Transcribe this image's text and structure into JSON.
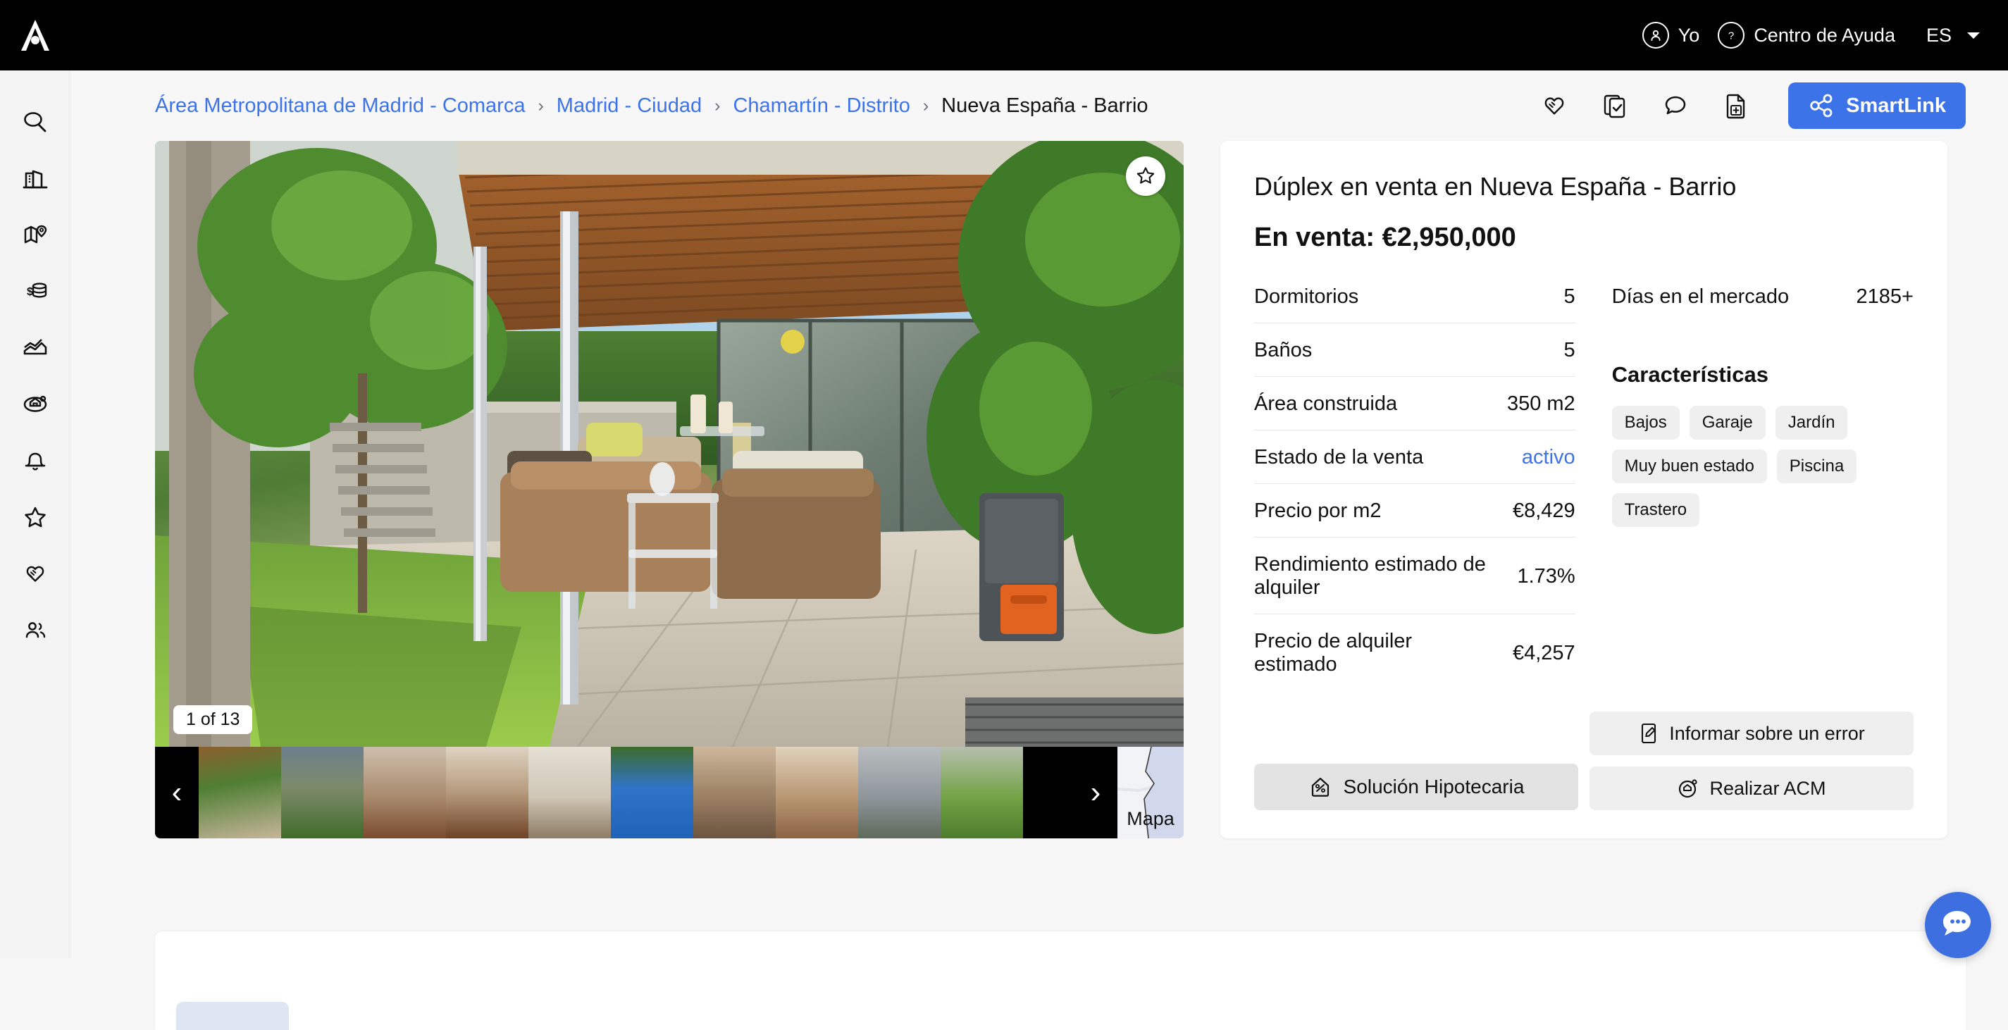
{
  "brand": {
    "logo_name": "a-logo",
    "accent": "#3d73e8"
  },
  "topbar": {
    "account_label": "Yo",
    "help_label": "Centro de Ayuda",
    "language": "ES"
  },
  "sidebar": {
    "items": [
      {
        "name": "search",
        "label": "Buscar"
      },
      {
        "name": "buildings",
        "label": "Edificios"
      },
      {
        "name": "map",
        "label": "Mapa"
      },
      {
        "name": "finance",
        "label": "Finanzas"
      },
      {
        "name": "analytics",
        "label": "Analítica"
      },
      {
        "name": "valuation",
        "label": "Valoración"
      },
      {
        "name": "alerts",
        "label": "Alertas"
      },
      {
        "name": "favorites",
        "label": "Favoritos"
      },
      {
        "name": "deals",
        "label": "Acuerdos"
      },
      {
        "name": "contacts",
        "label": "Contactos"
      }
    ]
  },
  "breadcrumb": {
    "items": [
      {
        "label": "Área Metropolitana de Madrid - Comarca",
        "current": false
      },
      {
        "label": "Madrid - Ciudad",
        "current": false
      },
      {
        "label": "Chamartín - Distrito",
        "current": false
      },
      {
        "label": "Nueva España - Barrio",
        "current": true
      }
    ],
    "separator": "›"
  },
  "header_actions": {
    "icons": [
      {
        "name": "handshake-icon"
      },
      {
        "name": "document-check-icon"
      },
      {
        "name": "chat-bubble-icon"
      },
      {
        "name": "document-add-icon"
      }
    ],
    "smartlink_label": "SmartLink"
  },
  "gallery": {
    "counter": "1 of 13",
    "prev_label": "‹",
    "next_label": "›",
    "map_label": "Mapa",
    "favorite_icon": "star-icon",
    "thumbnails": [
      {
        "name": "thumb-terrace"
      },
      {
        "name": "thumb-garden"
      },
      {
        "name": "thumb-living-room"
      },
      {
        "name": "thumb-dining"
      },
      {
        "name": "thumb-lounge"
      },
      {
        "name": "thumb-pool"
      },
      {
        "name": "thumb-bathroom"
      },
      {
        "name": "thumb-hallway"
      },
      {
        "name": "thumb-facade"
      },
      {
        "name": "thumb-lawn"
      }
    ]
  },
  "listing": {
    "title": "Dúplex en venta en Nueva España - Barrio",
    "price_label": "En venta: €2,950,000",
    "details_left": [
      {
        "label": "Dormitorios",
        "value": "5",
        "is_link": false
      },
      {
        "label": "Baños",
        "value": "5",
        "is_link": false
      },
      {
        "label": "Área construida",
        "value": "350 m2",
        "is_link": false
      },
      {
        "label": "Estado de la venta",
        "value": "activo",
        "is_link": true
      },
      {
        "label": "Precio por m2",
        "value": "€8,429",
        "is_link": false
      },
      {
        "label": "Rendimiento estimado de alquiler",
        "value": "1.73%",
        "is_link": false
      },
      {
        "label": "Precio de alquiler estimado",
        "value": "€4,257",
        "is_link": false
      }
    ],
    "details_right": [
      {
        "label": "Días en el mercado",
        "value": "2185+",
        "is_link": false
      }
    ],
    "features_title": "Características",
    "features": [
      "Bajos",
      "Garaje",
      "Jardín",
      "Muy buen estado",
      "Piscina",
      "Trastero"
    ],
    "buttons": {
      "mortgage": "Solución Hipotecaria",
      "report_error": "Informar sobre un error",
      "acm": "Realizar ACM"
    }
  }
}
